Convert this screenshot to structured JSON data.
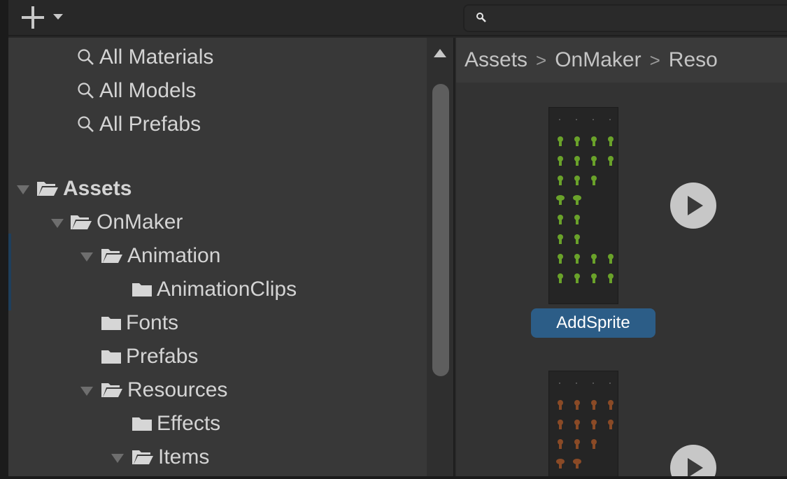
{
  "toolbar": {
    "add_icon": "plus-icon",
    "add_dropdown_icon": "caret-down-icon",
    "search_icon": "search-icon",
    "search_value": ""
  },
  "tree": {
    "favorites": [
      {
        "label": "All Materials",
        "icon": "search-icon"
      },
      {
        "label": "All Models",
        "icon": "search-icon"
      },
      {
        "label": "All Prefabs",
        "icon": "search-icon"
      }
    ],
    "items": [
      {
        "label": "Assets",
        "icon": "folder-open-icon",
        "expanded": true,
        "bold": true
      },
      {
        "label": "OnMaker",
        "icon": "folder-open-icon",
        "expanded": true
      },
      {
        "label": "Animation",
        "icon": "folder-open-icon",
        "expanded": true
      },
      {
        "label": "AnimationClips",
        "icon": "folder-icon"
      },
      {
        "label": "Fonts",
        "icon": "folder-icon"
      },
      {
        "label": "Prefabs",
        "icon": "folder-icon"
      },
      {
        "label": "Resources",
        "icon": "folder-open-icon",
        "expanded": true
      },
      {
        "label": "Effects",
        "icon": "folder-icon"
      },
      {
        "label": "Items",
        "icon": "folder-open-icon",
        "expanded": true
      }
    ]
  },
  "breadcrumb": [
    "Assets",
    "OnMaker",
    "Reso"
  ],
  "assets": [
    {
      "label": "AddSprite",
      "selected": true,
      "tint": "#6aa22a"
    },
    {
      "label": "",
      "selected": false,
      "tint": "#8a4a26"
    }
  ],
  "colors": {
    "panel_bg": "#383838",
    "content_bg": "#333333",
    "selection": "#2c5d87"
  }
}
